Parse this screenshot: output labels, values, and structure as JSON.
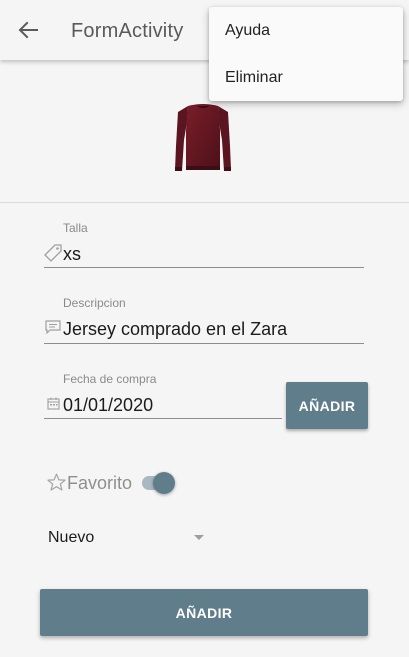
{
  "appbar": {
    "title": "FormActivity",
    "back_icon": "arrow-back-icon"
  },
  "menu": {
    "items": [
      {
        "label": "Ayuda"
      },
      {
        "label": "Eliminar"
      }
    ]
  },
  "image": {
    "icon": "sweater-image"
  },
  "form": {
    "talla": {
      "label": "Talla",
      "value": "xs",
      "icon": "tag-icon"
    },
    "descripcion": {
      "label": "Descripcion",
      "value": "Jersey comprado en el Zara",
      "icon": "comment-icon"
    },
    "fecha": {
      "label": "Fecha de compra",
      "value": "01/01/2020",
      "icon": "calendar-icon",
      "button_label": "AÑADIR"
    },
    "favorito": {
      "label": "Favorito",
      "icon": "star-outline-icon",
      "checked": true
    },
    "estado": {
      "value": "Nuevo"
    },
    "submit_label": "AÑADIR"
  },
  "colors": {
    "accent": "#607d8b",
    "background": "#f5f5f5",
    "switch_track": "#a9b8c0"
  }
}
